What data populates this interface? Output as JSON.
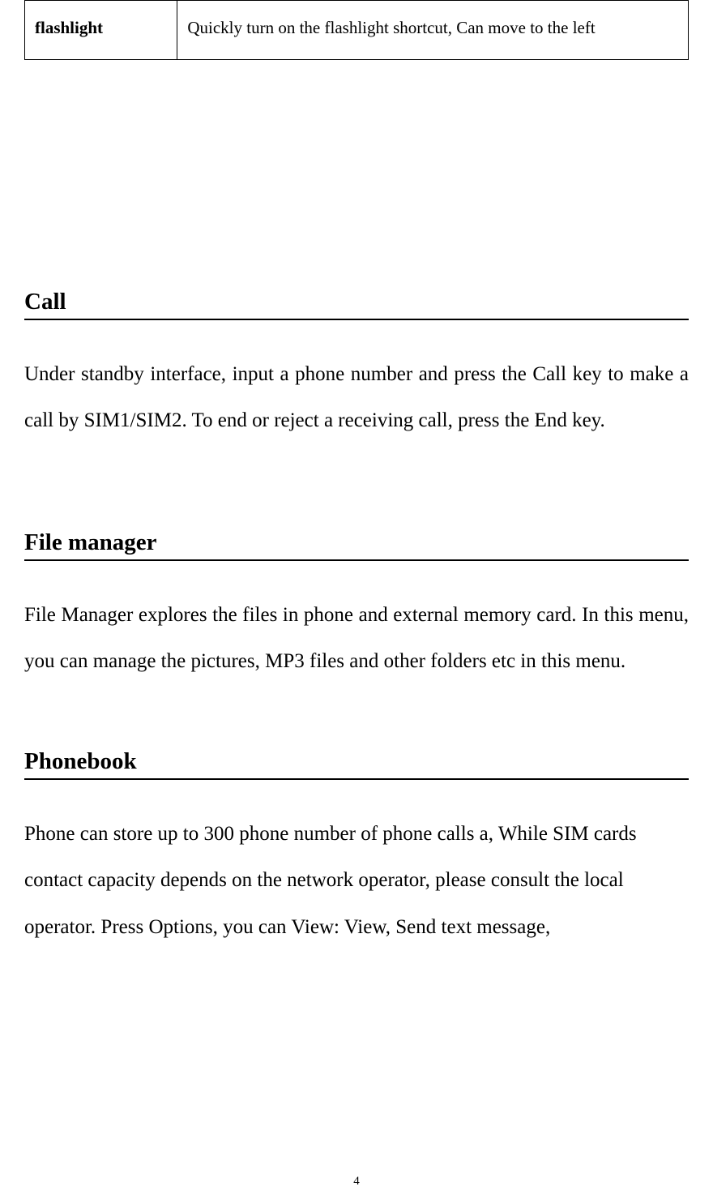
{
  "table": {
    "row1": {
      "label": "flashlight",
      "desc": "Quickly turn on the flashlight shortcut, Can move to the left"
    }
  },
  "sections": {
    "call": {
      "heading": "Call",
      "body": "Under standby interface, input a phone number and press the Call key to make a call by SIM1/SIM2. To end or reject a receiving call, press the End key."
    },
    "filemanager": {
      "heading": "File manager",
      "body": "File Manager explores the files in phone and external memory card. In this menu, you can manage the pictures, MP3 files and other folders etc in this menu."
    },
    "phonebook": {
      "heading": "Phonebook",
      "body": "Phone can store up to 300 phone number of phone calls a, While SIM cards contact capacity depends on the network operator, please consult the local operator. Press Options, you can View: View, Send text message,"
    }
  },
  "page_number": "4"
}
